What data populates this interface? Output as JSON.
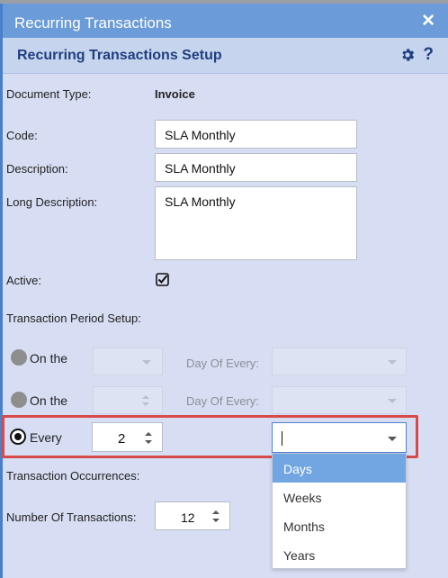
{
  "window": {
    "title": "Recurring Transactions",
    "close_icon": "close-icon"
  },
  "header": {
    "title": "Recurring Transactions Setup",
    "settings_icon": "gear-icon",
    "help_label": "?"
  },
  "form": {
    "document_type_label": "Document Type:",
    "document_type_value": "Invoice",
    "code_label": "Code:",
    "code_value": "SLA Monthly",
    "description_label": "Description:",
    "description_value": "SLA Monthly",
    "long_description_label": "Long Description:",
    "long_description_value": "SLA Monthly",
    "active_label": "Active:",
    "active_checked": true
  },
  "period": {
    "section_label": "Transaction Period Setup:",
    "row1": {
      "label": "On the",
      "day_of_every_label": "Day Of Every:"
    },
    "row2": {
      "label": "On the",
      "day_of_every_label": "Day Of Every:"
    },
    "row3": {
      "label": "Every",
      "value": "2",
      "unit_value": ""
    }
  },
  "dropdown": {
    "options": [
      "Days",
      "Weeks",
      "Months",
      "Years"
    ],
    "highlighted": "Days"
  },
  "occurrences": {
    "section_label": "Transaction Occurrences:",
    "number_label": "Number Of Transactions:",
    "number_value": "12"
  },
  "colors": {
    "titlebar": "#6b9bd8",
    "header_text": "#1f3f80",
    "background": "#d7def3",
    "highlight_border": "#d94a4a",
    "selected_option": "#72a6e2"
  }
}
